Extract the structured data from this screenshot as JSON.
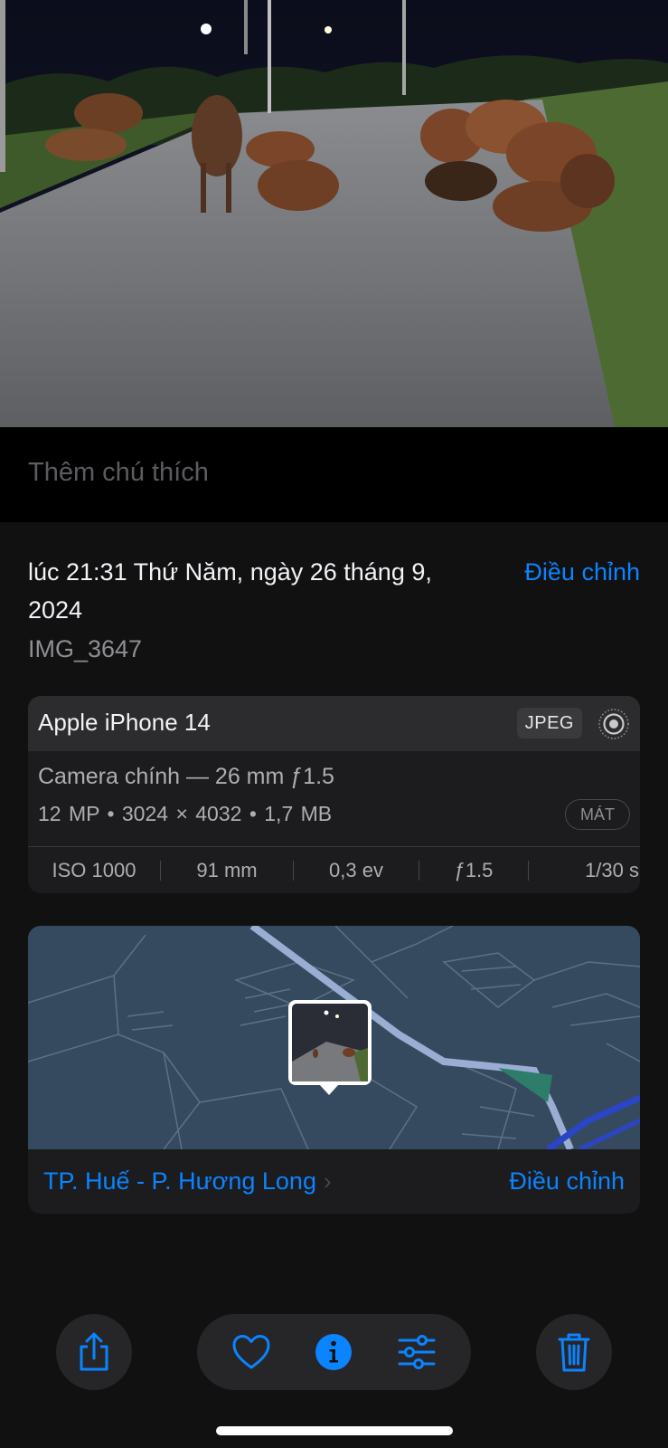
{
  "caption": {
    "placeholder": "Thêm chú thích"
  },
  "details": {
    "datetime": "lúc 21:31 Thứ Năm, ngày 26 tháng 9, 2024",
    "adjust_label": "Điều chỉnh",
    "filename": "IMG_3647"
  },
  "camera": {
    "device": "Apple iPhone 14",
    "format": "JPEG",
    "lens": "Camera chính — 26 mm ƒ1.5",
    "specs": "12 MP  •  3024 × 4032  •  1,7 MB",
    "mat_label": "MÁT",
    "exif": [
      {
        "label": "ISO 1000"
      },
      {
        "label": "91 mm"
      },
      {
        "label": "0,3 ev"
      },
      {
        "label": "ƒ1.5"
      },
      {
        "label": "1/30 s"
      }
    ]
  },
  "location": {
    "place": "TP. Huế - P. Hương Long",
    "adjust_label": "Điều chỉnh"
  },
  "toolbar": {
    "share_icon": "share-icon",
    "favorite_icon": "heart-icon",
    "info_icon": "info-icon",
    "edit_icon": "sliders-icon",
    "delete_icon": "trash-icon"
  },
  "colors": {
    "accent": "#0a84ff",
    "panel": "#111112",
    "card": "#1c1c1e"
  }
}
